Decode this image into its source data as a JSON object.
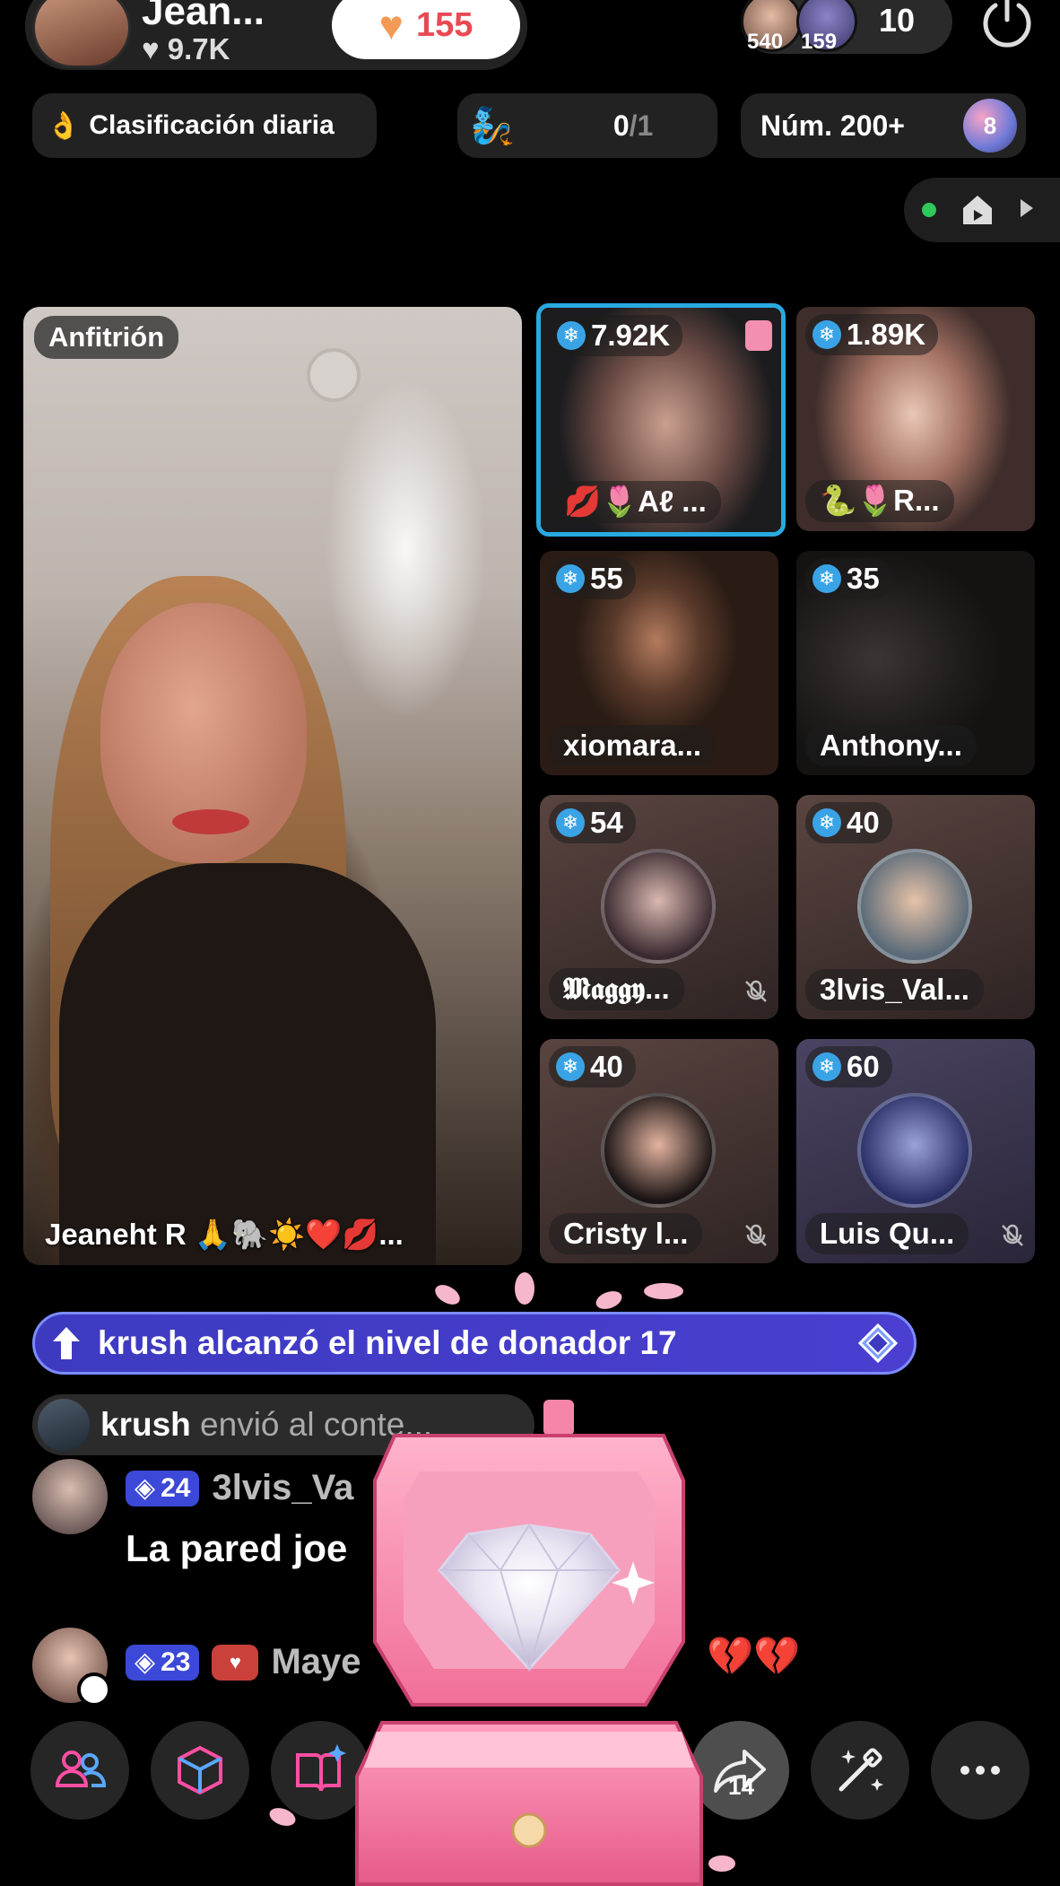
{
  "host": {
    "name": "Jean...",
    "likes": "9.7K",
    "heart_count": "155",
    "video_label": "Anfitrión",
    "caption": "Jeaneht R 🙏🐘☀️❤️💋..."
  },
  "viewers": {
    "avatar_badges": [
      "540",
      "159"
    ],
    "count": "10"
  },
  "status_row": {
    "ranking_label": "Clasificación diaria",
    "goal_current": "0",
    "goal_total": "/1",
    "rank_label": "Núm. 200+",
    "rank_badge": "8"
  },
  "guests": [
    {
      "score": "7.92K",
      "name": "💋🌷Aℓ ...",
      "highlighted": true
    },
    {
      "score": "1.89K",
      "name": "🐍🌷R..."
    },
    {
      "score": "55",
      "name": "xiomara..."
    },
    {
      "score": "35",
      "name": "Anthony..."
    },
    {
      "score": "54",
      "name": "𝕸𝖆𝖌𝖌𝖞...",
      "muted": true
    },
    {
      "score": "40",
      "name": "3lvis_Val..."
    },
    {
      "score": "40",
      "name": "Cristy l...",
      "muted": true
    },
    {
      "score": "60",
      "name": "Luis Qu...",
      "muted": true
    }
  ],
  "banners": {
    "level_up": "krush alcanzó el nivel de donador 17",
    "gift_user": "krush",
    "gift_text": " envió al conte..."
  },
  "chat": [
    {
      "level": "24",
      "name": "3lvis_Va",
      "message": "La pared joe"
    },
    {
      "level": "23",
      "name": "Maye",
      "emoji": "💔💔"
    }
  ],
  "toolbar": {
    "share_count": "14"
  },
  "colors": {
    "accent_blue": "#29a9e0",
    "level_banner": "#3d3ac0",
    "likes_heart": "#f39a55",
    "likes_number": "#e84a54",
    "toolbar_pink": "#ff4fa3"
  }
}
